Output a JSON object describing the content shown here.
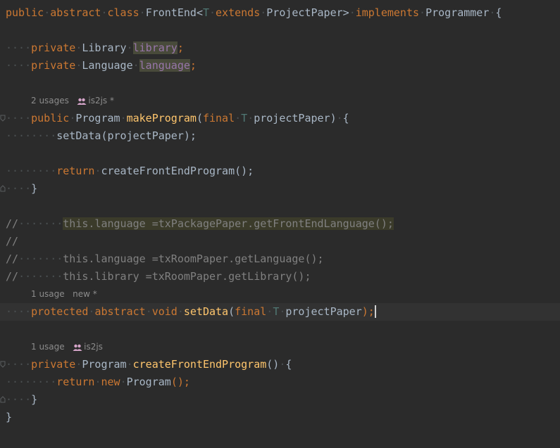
{
  "lines": {
    "l1": {
      "k1": "public",
      "k2": "abstract",
      "k3": "class",
      "name": "FrontEnd",
      "lt": "<",
      "T": "T",
      "k4": "extends",
      "paper": "ProjectPaper",
      "gt": ">",
      "k5": "implements",
      "iface": "Programmer",
      "brace": "{"
    },
    "l2": {
      "k": "private",
      "type": "Library",
      "field": "library",
      "semi": ";"
    },
    "l3": {
      "k": "private",
      "type": "Language",
      "field": "language",
      "semi": ";"
    },
    "hint1": {
      "usages": "2 usages",
      "author": "is2js *"
    },
    "l4": {
      "k": "public",
      "type": "Program",
      "fn": "makeProgram",
      "lp": "(",
      "k2": "final",
      "T": "T",
      "param": "projectPaper",
      "rp": ")",
      "brace": "{"
    },
    "l5": {
      "fn": "setData",
      "args": "(projectPaper);"
    },
    "l6": {
      "k": "return",
      "fn": "createFrontEndProgram",
      "tail": "();"
    },
    "l7": {
      "brace": "}"
    },
    "c1": {
      "slashes": "//",
      "text": "this.language =txPackagePaper.getFrontEndLanguage();"
    },
    "c2": {
      "slashes": "//"
    },
    "c3": {
      "slashes": "//",
      "text": "this.language =txRoomPaper.getLanguage();"
    },
    "c4": {
      "slashes": "//",
      "text": "this.library =txRoomPaper.getLibrary();"
    },
    "hint2": {
      "usages": "1 usage",
      "author": "new *"
    },
    "l8": {
      "k1": "protected",
      "k2": "abstract",
      "k3": "void",
      "fn": "setData",
      "lp": "(",
      "k4": "final",
      "T": "T",
      "param": "projectPaper",
      "tail": ");"
    },
    "hint3": {
      "usages": "1 usage",
      "author": "is2js"
    },
    "l9": {
      "k": "private",
      "type": "Program",
      "fn": "createFrontEndProgram",
      "tail": "()",
      "brace": "{"
    },
    "l10": {
      "k1": "return",
      "k2": "new",
      "type": "Program",
      "tail": "();"
    },
    "l11": {
      "brace": "}"
    },
    "l12": {
      "brace": "}"
    }
  },
  "colors": {
    "background": "#2b2b2b",
    "keyword": "#cc7832",
    "function": "#ffc66d",
    "field": "#9876aa",
    "comment": "#808080",
    "text": "#a9b7c6"
  },
  "icons": {
    "author": "users-icon",
    "fold": "fold-marker-icon"
  }
}
